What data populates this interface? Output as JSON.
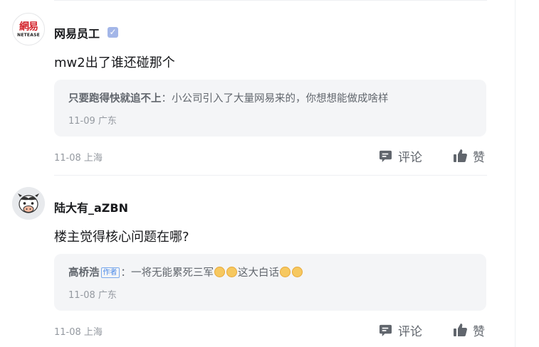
{
  "comments": [
    {
      "username": "网易员工",
      "avatar_lines": [
        "網易",
        "NETEASE"
      ],
      "content": "mw2出了谁还碰那个",
      "reply": {
        "author": "只要跑得快就追不上",
        "sep": "：",
        "text": "小公司引入了大量网易来的，你想想能做成啥样",
        "meta": "11-09 广东"
      },
      "time": "11-08 上海",
      "comment_label": "评论",
      "like_label": "赞"
    },
    {
      "username": "陆大有_aZBN",
      "content": "楼主觉得核心问题在哪?",
      "reply": {
        "author": "高桥浩",
        "tag": "作者",
        "sep": "：",
        "text1": "一将无能累死三军",
        "text2": "这大白话",
        "meta": "11-08 广东"
      },
      "time": "11-08 上海",
      "comment_label": "评论",
      "like_label": "赞"
    }
  ],
  "colors": {
    "verified": "#a3b6e8",
    "tag": "#4a8ae8",
    "reply_bg": "#f4f5f7"
  }
}
